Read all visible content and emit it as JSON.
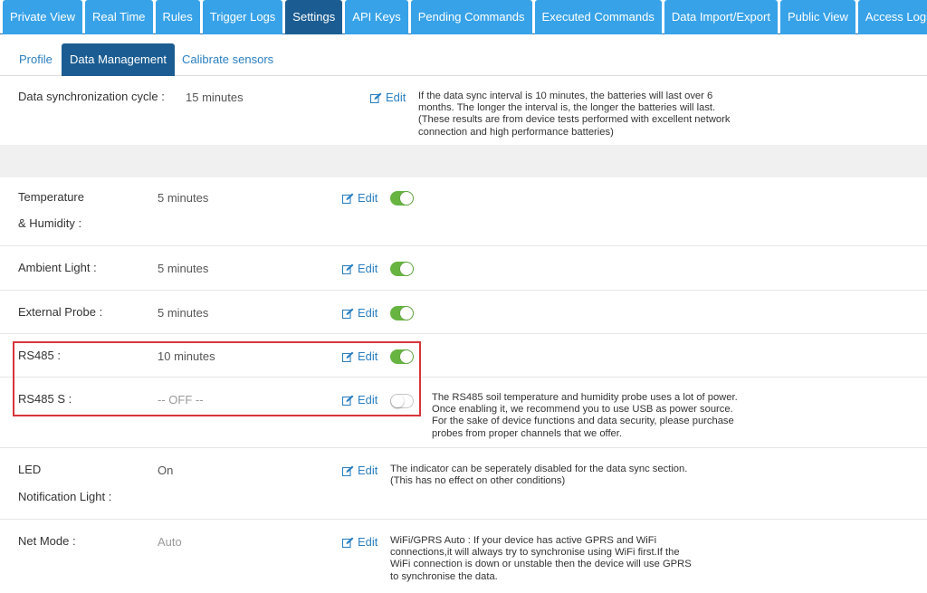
{
  "top_tabs": [
    {
      "label": "Private View",
      "active": false
    },
    {
      "label": "Real Time",
      "active": false
    },
    {
      "label": "Rules",
      "active": false
    },
    {
      "label": "Trigger Logs",
      "active": false
    },
    {
      "label": "Settings",
      "active": true
    },
    {
      "label": "API Keys",
      "active": false
    },
    {
      "label": "Pending Commands",
      "active": false
    },
    {
      "label": "Executed Commands",
      "active": false
    },
    {
      "label": "Data Import/Export",
      "active": false
    },
    {
      "label": "Public View",
      "active": false
    },
    {
      "label": "Access Logs",
      "active": false
    }
  ],
  "sub_tabs": [
    {
      "label": "Profile",
      "active": false
    },
    {
      "label": "Data Management",
      "active": true
    },
    {
      "label": "Calibrate sensors",
      "active": false
    }
  ],
  "edit_label": "Edit",
  "colors": {
    "tab_bg": "#37a2e8",
    "tab_active_bg": "#1b5d92",
    "link": "#2a7fc1",
    "toggle_on": "#67b441",
    "highlight": "#d7363b"
  },
  "sync": {
    "label": "Data synchronization cycle :",
    "value": "15 minutes",
    "note": "If the data sync interval is 10 minutes, the batteries will last over 6 months. The longer the interval is, the longer the batteries will last. (These results are from device tests performed with excellent network connection and high performance batteries)"
  },
  "settings": [
    {
      "label_line1": "Temperature",
      "label_line2": "& Humidity :",
      "value": "5 minutes",
      "toggle": "on"
    },
    {
      "label": "Ambient Light :",
      "value": "5 minutes",
      "toggle": "on"
    },
    {
      "label": "External Probe :",
      "value": "5 minutes",
      "toggle": "on"
    },
    {
      "label": "RS485 :",
      "value": "10 minutes",
      "toggle": "on"
    },
    {
      "label": "RS485 S :",
      "value": "-- OFF --",
      "toggle": "off",
      "note": "The RS485 soil temperature and humidity probe uses a lot of power. Once enabling it, we recommend you to use USB as power source. For the sake of device functions and data security, please purchase probes from proper channels that we offer."
    },
    {
      "label_line1": "LED",
      "label_line2": "Notification Light :",
      "value": "On",
      "note": "The indicator can be seperately disabled for the data sync section. (This has no effect on other conditions)"
    },
    {
      "label": "Net Mode :",
      "value": "Auto",
      "note": "WiFi/GPRS Auto : If your device has active GPRS and WiFi connections,it will always try to synchronise using WiFi first.If the WiFi connection is down or unstable then the device will use GPRS to synchronise the data."
    }
  ]
}
